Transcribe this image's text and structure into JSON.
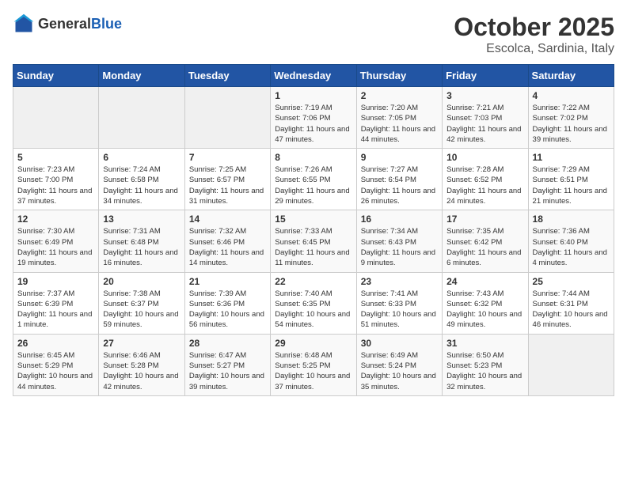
{
  "header": {
    "logo_general": "General",
    "logo_blue": "Blue",
    "title": "October 2025",
    "subtitle": "Escolca, Sardinia, Italy"
  },
  "days_of_week": [
    "Sunday",
    "Monday",
    "Tuesday",
    "Wednesday",
    "Thursday",
    "Friday",
    "Saturday"
  ],
  "weeks": [
    [
      {
        "day": "",
        "content": ""
      },
      {
        "day": "",
        "content": ""
      },
      {
        "day": "",
        "content": ""
      },
      {
        "day": "1",
        "content": "Sunrise: 7:19 AM\nSunset: 7:06 PM\nDaylight: 11 hours and 47 minutes."
      },
      {
        "day": "2",
        "content": "Sunrise: 7:20 AM\nSunset: 7:05 PM\nDaylight: 11 hours and 44 minutes."
      },
      {
        "day": "3",
        "content": "Sunrise: 7:21 AM\nSunset: 7:03 PM\nDaylight: 11 hours and 42 minutes."
      },
      {
        "day": "4",
        "content": "Sunrise: 7:22 AM\nSunset: 7:02 PM\nDaylight: 11 hours and 39 minutes."
      }
    ],
    [
      {
        "day": "5",
        "content": "Sunrise: 7:23 AM\nSunset: 7:00 PM\nDaylight: 11 hours and 37 minutes."
      },
      {
        "day": "6",
        "content": "Sunrise: 7:24 AM\nSunset: 6:58 PM\nDaylight: 11 hours and 34 minutes."
      },
      {
        "day": "7",
        "content": "Sunrise: 7:25 AM\nSunset: 6:57 PM\nDaylight: 11 hours and 31 minutes."
      },
      {
        "day": "8",
        "content": "Sunrise: 7:26 AM\nSunset: 6:55 PM\nDaylight: 11 hours and 29 minutes."
      },
      {
        "day": "9",
        "content": "Sunrise: 7:27 AM\nSunset: 6:54 PM\nDaylight: 11 hours and 26 minutes."
      },
      {
        "day": "10",
        "content": "Sunrise: 7:28 AM\nSunset: 6:52 PM\nDaylight: 11 hours and 24 minutes."
      },
      {
        "day": "11",
        "content": "Sunrise: 7:29 AM\nSunset: 6:51 PM\nDaylight: 11 hours and 21 minutes."
      }
    ],
    [
      {
        "day": "12",
        "content": "Sunrise: 7:30 AM\nSunset: 6:49 PM\nDaylight: 11 hours and 19 minutes."
      },
      {
        "day": "13",
        "content": "Sunrise: 7:31 AM\nSunset: 6:48 PM\nDaylight: 11 hours and 16 minutes."
      },
      {
        "day": "14",
        "content": "Sunrise: 7:32 AM\nSunset: 6:46 PM\nDaylight: 11 hours and 14 minutes."
      },
      {
        "day": "15",
        "content": "Sunrise: 7:33 AM\nSunset: 6:45 PM\nDaylight: 11 hours and 11 minutes."
      },
      {
        "day": "16",
        "content": "Sunrise: 7:34 AM\nSunset: 6:43 PM\nDaylight: 11 hours and 9 minutes."
      },
      {
        "day": "17",
        "content": "Sunrise: 7:35 AM\nSunset: 6:42 PM\nDaylight: 11 hours and 6 minutes."
      },
      {
        "day": "18",
        "content": "Sunrise: 7:36 AM\nSunset: 6:40 PM\nDaylight: 11 hours and 4 minutes."
      }
    ],
    [
      {
        "day": "19",
        "content": "Sunrise: 7:37 AM\nSunset: 6:39 PM\nDaylight: 11 hours and 1 minute."
      },
      {
        "day": "20",
        "content": "Sunrise: 7:38 AM\nSunset: 6:37 PM\nDaylight: 10 hours and 59 minutes."
      },
      {
        "day": "21",
        "content": "Sunrise: 7:39 AM\nSunset: 6:36 PM\nDaylight: 10 hours and 56 minutes."
      },
      {
        "day": "22",
        "content": "Sunrise: 7:40 AM\nSunset: 6:35 PM\nDaylight: 10 hours and 54 minutes."
      },
      {
        "day": "23",
        "content": "Sunrise: 7:41 AM\nSunset: 6:33 PM\nDaylight: 10 hours and 51 minutes."
      },
      {
        "day": "24",
        "content": "Sunrise: 7:43 AM\nSunset: 6:32 PM\nDaylight: 10 hours and 49 minutes."
      },
      {
        "day": "25",
        "content": "Sunrise: 7:44 AM\nSunset: 6:31 PM\nDaylight: 10 hours and 46 minutes."
      }
    ],
    [
      {
        "day": "26",
        "content": "Sunrise: 6:45 AM\nSunset: 5:29 PM\nDaylight: 10 hours and 44 minutes."
      },
      {
        "day": "27",
        "content": "Sunrise: 6:46 AM\nSunset: 5:28 PM\nDaylight: 10 hours and 42 minutes."
      },
      {
        "day": "28",
        "content": "Sunrise: 6:47 AM\nSunset: 5:27 PM\nDaylight: 10 hours and 39 minutes."
      },
      {
        "day": "29",
        "content": "Sunrise: 6:48 AM\nSunset: 5:25 PM\nDaylight: 10 hours and 37 minutes."
      },
      {
        "day": "30",
        "content": "Sunrise: 6:49 AM\nSunset: 5:24 PM\nDaylight: 10 hours and 35 minutes."
      },
      {
        "day": "31",
        "content": "Sunrise: 6:50 AM\nSunset: 5:23 PM\nDaylight: 10 hours and 32 minutes."
      },
      {
        "day": "",
        "content": ""
      }
    ]
  ]
}
